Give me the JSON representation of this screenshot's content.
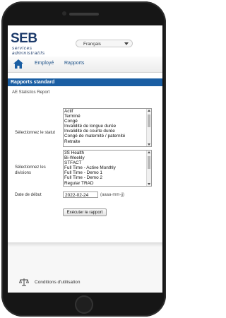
{
  "logo": {
    "mark": "SEB",
    "sub": "services administratifs"
  },
  "language": {
    "selected": "Français"
  },
  "nav": {
    "employee": "Employé",
    "reports": "Rapports"
  },
  "section": {
    "title": "Rapports standard"
  },
  "report": {
    "name": "AE Statistics Report"
  },
  "status": {
    "label": "Sélectionnez le statut",
    "options": [
      "Actif",
      "Terminé",
      "Congé",
      "Invalidité de longue durée",
      "Invalidité de courte durée",
      "Congé de maternité / paternité",
      "Retraite"
    ]
  },
  "divisions": {
    "label": "Sélectionnez les divisions",
    "options": [
      "3S Health",
      "Bi-Weekly",
      "STFACT",
      "Full Time - Active Monthly",
      "Full Time - Demo 1",
      "Full Time - Demo 2",
      "Regular TRAD"
    ]
  },
  "start_date": {
    "label": "Date de début",
    "value": "2022-02-24",
    "hint": "(aaaa-mm-jj)"
  },
  "run_button": {
    "label": "Exécuter le rapport"
  },
  "footer": {
    "terms": "Conditions d'utilisation"
  },
  "colors": {
    "accent": "#1a5ea3",
    "brand": "#1c3a6a",
    "phone": "#161616"
  },
  "icons": {
    "home": "home-icon",
    "terms": "scales-icon"
  }
}
